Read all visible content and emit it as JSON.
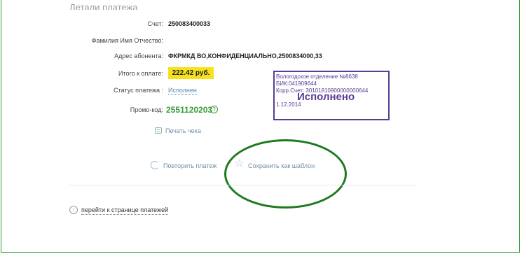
{
  "details": {
    "heading": "Детали платежа",
    "account_label": "Счет:",
    "account_value": "250083400033",
    "fio_label": "Фамилия Имя Отчество:",
    "fio_value": "",
    "address_label": "Адрес абонента:",
    "address_value": "ФКРМКД ВО,КОНФИДЕНЦИАЛЬНО,2500834000,33",
    "total_label": "Итого к оплате:",
    "total_value": "222.42 руб.",
    "status_label": "Статус платежа :",
    "status_value": "Исполнен",
    "promo_label": "Промо-код:",
    "promo_value": "2551120203",
    "help_icon_glyph": "?"
  },
  "stamp": {
    "line1": "Вологодское отделение №8638",
    "line2": "БИК:041909644",
    "line3": "Корр.Счет: 30101810900000000644",
    "big": "Исполнено",
    "date": "1.12.2014",
    "color": "#5b3c93"
  },
  "actions": {
    "print_label": "Печать чека",
    "repeat_label": "Повторить платеж",
    "save_template_label": "Сохранить как шаблон",
    "star_glyph": "☆"
  },
  "footer": {
    "back_label": "перейти к странице платежей",
    "up_glyph": "↑"
  },
  "colors": {
    "highlight": "#f7e11c",
    "promo": "#3a9a3a",
    "annotation_ellipse": "#1e7a1e"
  }
}
